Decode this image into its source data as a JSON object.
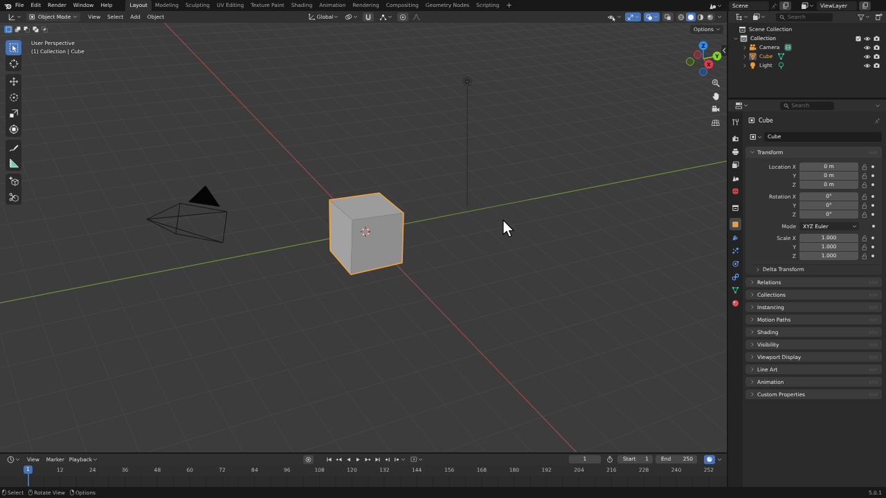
{
  "top_bar": {
    "menus": [
      "File",
      "Edit",
      "Render",
      "Window",
      "Help"
    ],
    "workspaces": [
      {
        "label": "Layout",
        "selected": true
      },
      {
        "label": "Modeling",
        "selected": false
      },
      {
        "label": "Sculpting",
        "selected": false
      },
      {
        "label": "UV Editing",
        "selected": false
      },
      {
        "label": "Texture Paint",
        "selected": false
      },
      {
        "label": "Shading",
        "selected": false
      },
      {
        "label": "Animation",
        "selected": false
      },
      {
        "label": "Rendering",
        "selected": false
      },
      {
        "label": "Compositing",
        "selected": false
      },
      {
        "label": "Geometry Nodes",
        "selected": false
      },
      {
        "label": "Scripting",
        "selected": false
      }
    ],
    "add_workspace": "+",
    "scene": "Scene",
    "view_layer": "ViewLayer"
  },
  "viewport": {
    "header": {
      "mode": "Object Mode",
      "menus": [
        "View",
        "Select",
        "Add",
        "Object"
      ],
      "orientation": "Global",
      "snap": {
        "on": false
      },
      "proportional_editing": {
        "on": false
      },
      "gizmos": {
        "on": true
      },
      "overlays": {
        "on": true
      },
      "xray": {
        "on": false
      },
      "shading_modes": [
        {
          "kind": "wireframe",
          "selected": false
        },
        {
          "kind": "solid",
          "selected": true
        },
        {
          "kind": "material",
          "selected": false
        },
        {
          "kind": "rendered",
          "selected": false
        }
      ]
    },
    "select_modes": [
      {
        "kind": "set",
        "selected": true
      },
      {
        "kind": "extend",
        "selected": false
      },
      {
        "kind": "subtract",
        "selected": false
      },
      {
        "kind": "invert",
        "selected": false
      },
      {
        "kind": "intersect",
        "selected": false
      }
    ],
    "options": "Options",
    "toolbar": [
      {
        "tools": [
          {
            "kind": "select",
            "selected": true
          },
          {
            "kind": "cursor",
            "selected": false
          }
        ]
      },
      {
        "tools": [
          {
            "kind": "move",
            "selected": false
          },
          {
            "kind": "rotate",
            "selected": false
          },
          {
            "kind": "scale",
            "selected": false
          },
          {
            "kind": "transform",
            "selected": false
          }
        ]
      },
      {
        "tools": [
          {
            "kind": "annotate",
            "selected": false
          },
          {
            "kind": "measure",
            "selected": false
          }
        ]
      },
      {
        "tools": [
          {
            "kind": "addcube",
            "selected": false
          },
          {
            "kind": "knife",
            "selected": false
          }
        ]
      }
    ],
    "info": [
      "User Perspective",
      "(1) Collection | Cube"
    ],
    "gizmo_axes": [
      {
        "kind": "z",
        "label": "Z"
      },
      {
        "kind": "y",
        "label": "Y"
      },
      {
        "kind": "x",
        "label": "X"
      }
    ]
  },
  "outliner": {
    "search": {
      "placeholder": "Search"
    },
    "tree": [
      {
        "label": "Scene Collection",
        "kind": "scene",
        "children": [
          {
            "label": "Collection",
            "kind": "collection",
            "expanded": true,
            "selected": true,
            "checked": true,
            "visible": true,
            "renderable": true,
            "children": [
              {
                "label": "Camera",
                "kind": "camera",
                "expanded": false,
                "selected": false,
                "visible": true,
                "renderable": true
              },
              {
                "label": "Cube",
                "kind": "mesh",
                "expanded": false,
                "selected": true,
                "visible": true,
                "renderable": true
              },
              {
                "label": "Light",
                "kind": "light",
                "expanded": false,
                "selected": false,
                "visible": true,
                "renderable": true
              }
            ]
          }
        ]
      }
    ]
  },
  "properties": {
    "search": {
      "placeholder": "Search"
    },
    "tab_groups": [
      {
        "tabs": [
          {
            "kind": "tool",
            "selected": false
          }
        ]
      },
      {
        "tabs": [
          {
            "kind": "render",
            "selected": false
          },
          {
            "kind": "output",
            "selected": false
          },
          {
            "kind": "viewlayer",
            "selected": false
          },
          {
            "kind": "scene",
            "selected": false
          },
          {
            "kind": "world",
            "selected": false
          }
        ]
      },
      {
        "tabs": [
          {
            "kind": "collection",
            "selected": false
          }
        ]
      },
      {
        "tabs": [
          {
            "kind": "object",
            "selected": true
          },
          {
            "kind": "modifiers",
            "selected": false
          },
          {
            "kind": "particles",
            "selected": false
          },
          {
            "kind": "physics",
            "selected": false
          },
          {
            "kind": "constraints",
            "selected": false
          },
          {
            "kind": "data",
            "selected": false
          },
          {
            "kind": "material",
            "selected": false
          }
        ]
      }
    ],
    "object": "Cube",
    "datablock": "Cube",
    "panels": [
      {
        "title": "Transform",
        "expanded": true,
        "groups": [
          {
            "rows": [
              {
                "kind": "number",
                "label": "Location X",
                "value": "0 m",
                "locked": false
              },
              {
                "kind": "number",
                "label": "Y",
                "value": "0 m",
                "locked": false
              },
              {
                "kind": "number",
                "label": "Z",
                "value": "0 m",
                "locked": false
              }
            ]
          },
          {
            "rows": [
              {
                "kind": "number",
                "label": "Rotation X",
                "value": "0°",
                "locked": false
              },
              {
                "kind": "number",
                "label": "Y",
                "value": "0°",
                "locked": false
              },
              {
                "kind": "number",
                "label": "Z",
                "value": "0°",
                "locked": false
              }
            ]
          },
          {
            "rows": [
              {
                "kind": "dropdown",
                "label": "Mode",
                "value": "XYZ Euler"
              }
            ]
          },
          {
            "rows": [
              {
                "kind": "number",
                "label": "Scale X",
                "value": "1.000",
                "locked": false
              },
              {
                "kind": "number",
                "label": "Y",
                "value": "1.000",
                "locked": false
              },
              {
                "kind": "number",
                "label": "Z",
                "value": "1.000",
                "locked": false
              }
            ]
          }
        ],
        "subpanels": [
          {
            "title": "Delta Transform",
            "expanded": false
          }
        ]
      },
      {
        "title": "Relations",
        "expanded": false
      },
      {
        "title": "Collections",
        "expanded": false
      },
      {
        "title": "Instancing",
        "expanded": false
      },
      {
        "title": "Motion Paths",
        "expanded": false
      },
      {
        "title": "Shading",
        "expanded": false
      },
      {
        "title": "Visibility",
        "expanded": false
      },
      {
        "title": "Viewport Display",
        "expanded": false
      },
      {
        "title": "Line Art",
        "expanded": false
      },
      {
        "title": "Animation",
        "expanded": false
      },
      {
        "title": "Custom Properties",
        "expanded": false
      }
    ]
  },
  "timeline": {
    "menus": [
      "View",
      "Marker"
    ],
    "playback": "Playback",
    "auto_keying": {
      "on": false
    },
    "frame": "1",
    "start_label": "Start",
    "start": "1",
    "end_label": "End",
    "end": "250",
    "snap": {
      "on": true
    },
    "playhead": "1",
    "ruler": [
      "12",
      "24",
      "36",
      "48",
      "60",
      "72",
      "84",
      "96",
      "108",
      "120",
      "132",
      "144",
      "156",
      "168",
      "180",
      "192",
      "204",
      "216",
      "228",
      "240",
      "252"
    ]
  },
  "status_bar": {
    "hints": [
      {
        "kind": "left",
        "label": "Select"
      },
      {
        "kind": "middle",
        "label": "Rotate View"
      },
      {
        "kind": "right",
        "label": "Options"
      }
    ],
    "version": "5.0.1"
  }
}
